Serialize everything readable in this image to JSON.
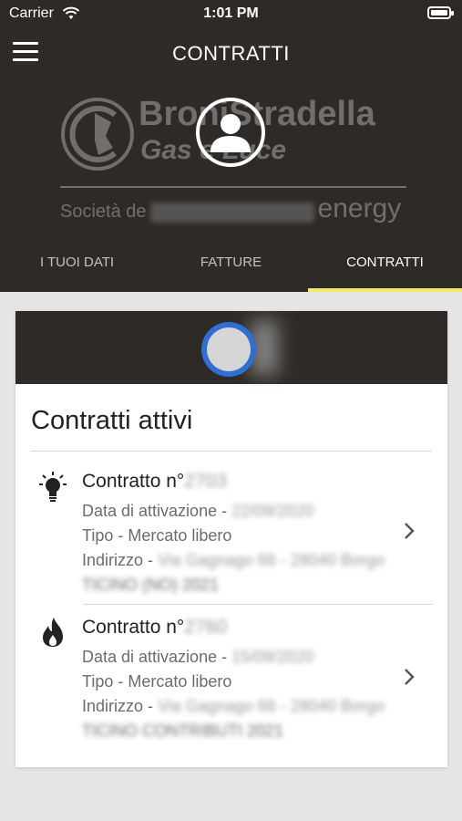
{
  "status_bar": {
    "carrier": "Carrier",
    "time": "1:01 PM"
  },
  "header": {
    "title": "CONTRATTI",
    "logo": {
      "line1": "BroniStradella",
      "line2": "Gas e Luce",
      "line3_prefix": "Società de",
      "line3_suffix": "energy"
    }
  },
  "tabs": [
    {
      "label": "I TUOI DATI"
    },
    {
      "label": "FATTURE"
    },
    {
      "label": "CONTRATTI"
    }
  ],
  "active_tab_index": 2,
  "section": {
    "title": "Contratti attivi"
  },
  "contracts": [
    {
      "icon": "lightbulb-icon",
      "title_prefix": "Contratto n°",
      "number": "2703",
      "activation_label": "Data di attivazione - ",
      "activation_date": "22/09/2020",
      "type": "Tipo - Mercato libero",
      "address_label": "Indirizzo - ",
      "address": "Via Gagnago 66 - 28040 Borgo",
      "address_cont": "TICINO (NO) 2021"
    },
    {
      "icon": "flame-icon",
      "title_prefix": "Contratto n°",
      "number": "2760",
      "activation_label": "Data di attivazione - ",
      "activation_date": "15/09/2020",
      "type": "Tipo - Mercato libero",
      "address_label": "Indirizzo - ",
      "address": "Via Gagnago 66 - 28040 Borgo",
      "address_cont": "TICINO CONTRIBUTI 2021"
    }
  ],
  "colors": {
    "header_bg": "#2d2a27",
    "tab_indicator": "#f2e96b",
    "badge_ring": "#2e6fd1",
    "page_bg": "#e6e6e6"
  }
}
